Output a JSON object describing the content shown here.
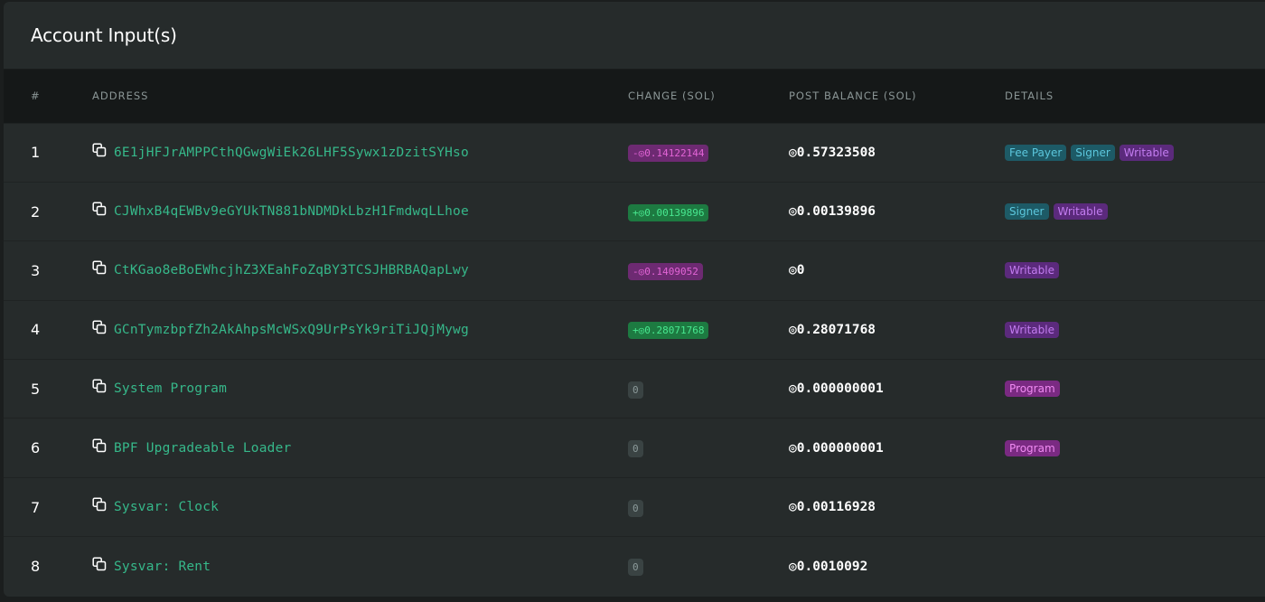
{
  "card": {
    "title": "Account Input(s)"
  },
  "table": {
    "headers": {
      "index": "#",
      "address": "ADDRESS",
      "change": "CHANGE (SOL)",
      "post_balance": "POST BALANCE (SOL)",
      "details": "DETAILS"
    },
    "rows": [
      {
        "index": "1",
        "address": "6E1jHFJrAMPPCthQGwgWiEk26LHF5Sywx1zDzitSYHso",
        "change": "-◎0.14122144",
        "change_kind": "negative",
        "post_balance": "◎0.57323508",
        "details": [
          "Fee Payer",
          "Signer",
          "Writable"
        ]
      },
      {
        "index": "2",
        "address": "CJWhxB4qEWBv9eGYUkTN881bNDMDkLbzH1FmdwqLLhoe",
        "change": "+◎0.00139896",
        "change_kind": "positive",
        "post_balance": "◎0.00139896",
        "details": [
          "Signer",
          "Writable"
        ]
      },
      {
        "index": "3",
        "address": "CtKGao8eBoEWhcjhZ3XEahFoZqBY3TCSJHBRBAQapLwy",
        "change": "-◎0.1409052",
        "change_kind": "negative",
        "post_balance": "◎0",
        "details": [
          "Writable"
        ]
      },
      {
        "index": "4",
        "address": "GCnTymzbpfZh2AkAhpsMcWSxQ9UrPsYk9riTiJQjMywg",
        "change": "+◎0.28071768",
        "change_kind": "positive",
        "post_balance": "◎0.28071768",
        "details": [
          "Writable"
        ]
      },
      {
        "index": "5",
        "address": "System Program",
        "change": "0",
        "change_kind": "zero",
        "post_balance": "◎0.000000001",
        "details": [
          "Program"
        ]
      },
      {
        "index": "6",
        "address": "BPF Upgradeable Loader",
        "change": "0",
        "change_kind": "zero",
        "post_balance": "◎0.000000001",
        "details": [
          "Program"
        ]
      },
      {
        "index": "7",
        "address": "Sysvar: Clock",
        "change": "0",
        "change_kind": "zero",
        "post_balance": "◎0.00116928",
        "details": []
      },
      {
        "index": "8",
        "address": "Sysvar: Rent",
        "change": "0",
        "change_kind": "zero",
        "post_balance": "◎0.0010092",
        "details": []
      }
    ]
  },
  "colors": {
    "accent_address": "#36b88a",
    "negative_change": "#e264d6",
    "positive_change": "#48e890",
    "signer_tag": "#5cc7dd",
    "writable_tag": "#c27cf0",
    "program_tag": "#f08af2"
  },
  "icons": {
    "copy": "copy-icon"
  }
}
